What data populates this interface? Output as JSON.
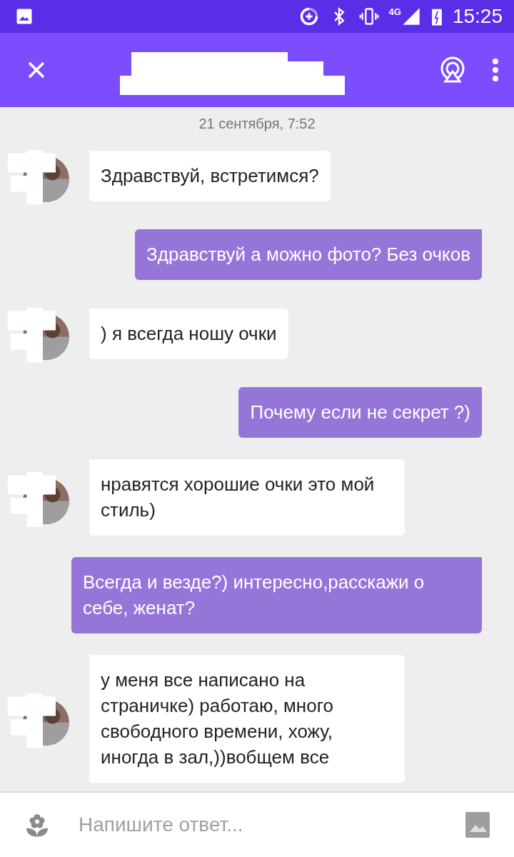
{
  "status_bar": {
    "time": "15:25",
    "network": "4G"
  },
  "date_divider": "21 сентября, 7:52",
  "messages": [
    {
      "kind": "in",
      "text": "Здравствуй, встретимся?"
    },
    {
      "kind": "out",
      "text": "Здравствуй а можно фото? Без очков"
    },
    {
      "kind": "in",
      "text": ") я всегда ношу очки"
    },
    {
      "kind": "out",
      "text": "Почему если не секрет ?)"
    },
    {
      "kind": "in",
      "text": "нравятся хорошие очки это мой стиль)"
    },
    {
      "kind": "out",
      "text": "Всегда и везде?) интересно,расскажи о себе, женат?"
    },
    {
      "kind": "in",
      "text": "у меня все написано на страничке) работаю, много свободного времени, хожу, иногда в зал,))вобщем все"
    }
  ],
  "composer": {
    "placeholder": "Напишите ответ..."
  }
}
